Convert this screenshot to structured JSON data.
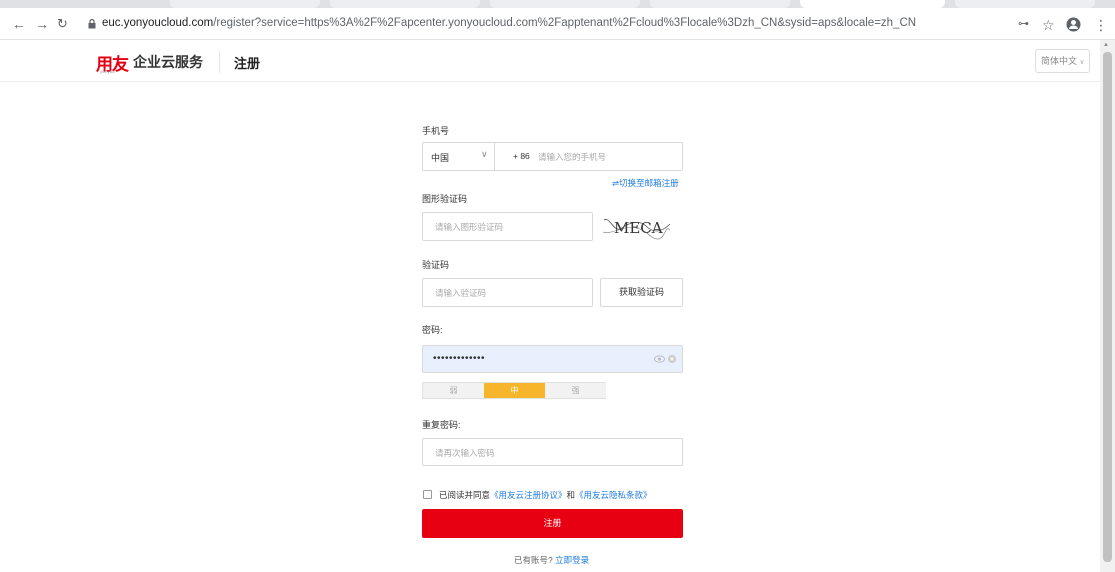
{
  "browser": {
    "url_domain": "euc.yonyoucloud.com",
    "url_path": "/register?service=https%3A%2F%2Fapcenter.yonyoucloud.com%2Fapptenant%2Fcloud%3Flocale%3Dzh_CN&sysid=aps&locale=zh_CN"
  },
  "header": {
    "logo": "用友",
    "logo_sub": "yonyou",
    "brand": "企业云服务",
    "title": "注册",
    "language": "简体中文"
  },
  "form": {
    "phone_label": "手机号",
    "country": "中国",
    "dial_code": "+ 86",
    "phone_placeholder": "请输入您的手机号",
    "switch_email": "⇌切换至邮箱注册",
    "captcha_label": "图形验证码",
    "captcha_placeholder": "请输入图形验证码",
    "captcha_text": "MECA",
    "code_label": "验证码",
    "code_placeholder": "请输入验证码",
    "get_code": "获取验证码",
    "password_label": "密码:",
    "password_value": "•••••••••••••",
    "strength": [
      "弱",
      "中",
      "强"
    ],
    "strength_level": "中",
    "repeat_label": "重复密码:",
    "repeat_placeholder": "请再次输入密码",
    "agree_text": "已阅读并同意",
    "agree_link1": "《用友云注册协议》",
    "agree_and": "和",
    "agree_link2": "《用友云隐私条款》",
    "submit": "注册",
    "have_account": "已有账号?",
    "login_link": "立即登录"
  },
  "colors": {
    "brand_red": "#e60012",
    "link_blue": "#1f7ce0",
    "strength_mid": "#f7b52c"
  }
}
